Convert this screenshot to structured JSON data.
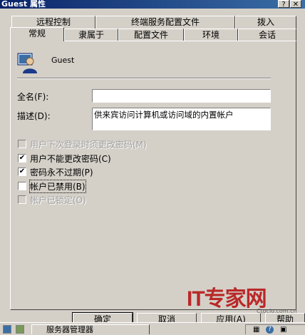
{
  "window": {
    "title": "Guest 属性",
    "help_btn": "?",
    "close_btn": "✕"
  },
  "tabs_row1": [
    {
      "label": "远程控制"
    },
    {
      "label": "终端服务配置文件"
    },
    {
      "label": "拨入"
    }
  ],
  "tabs_row2": [
    {
      "label": "常规",
      "active": true
    },
    {
      "label": "隶属于"
    },
    {
      "label": "配置文件"
    },
    {
      "label": "环境"
    },
    {
      "label": "会话"
    }
  ],
  "user": {
    "name": "Guest",
    "icon": "user-icon"
  },
  "fields": {
    "fullname_label": "全名(F):",
    "fullname_value": "",
    "description_label": "描述(D):",
    "description_value": "供来宾访问计算机或访问域的内置帐户"
  },
  "options": [
    {
      "label": "用户下次登录时须更改密码(M)",
      "checked": false,
      "disabled": true
    },
    {
      "label": "用户不能更改密码(C)",
      "checked": true,
      "disabled": false
    },
    {
      "label": "密码永不过期(P)",
      "checked": true,
      "disabled": false
    },
    {
      "label": "帐户已禁用(B)",
      "checked": false,
      "disabled": false
    },
    {
      "label": "帐户已锁定(O)",
      "checked": false,
      "disabled": true
    }
  ],
  "buttons": {
    "ok": "确定",
    "cancel": "取消",
    "apply": "应用(A)",
    "help": "帮助"
  },
  "watermark": {
    "text": "IT专家网",
    "sub": "Ctocio.com.cn"
  },
  "taskbar": {
    "item_label": "服务器管理器"
  },
  "colors": {
    "titlebar": "#0a246a",
    "face": "#d4d0c8",
    "watermark": "#b92828"
  }
}
